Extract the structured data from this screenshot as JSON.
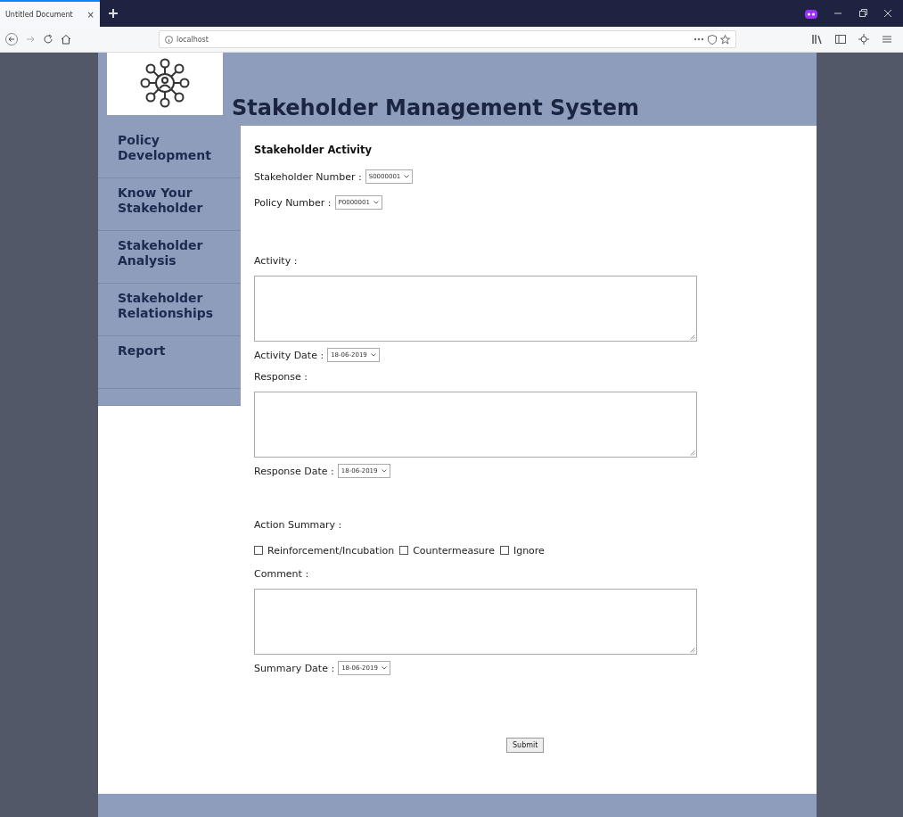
{
  "browser": {
    "tab_title": "Untitled Document",
    "tab_close": "×",
    "url": "localhost"
  },
  "header": {
    "title": "Stakeholder Management System"
  },
  "sidebar": {
    "items": [
      {
        "label": "Policy Development",
        "selected": false
      },
      {
        "label": "Know Your Stakeholder",
        "selected": false
      },
      {
        "label": "Stakeholder Analysis",
        "selected": false
      },
      {
        "label": "Stakeholder Relationships",
        "selected": false
      },
      {
        "label": "Report",
        "selected": false
      }
    ]
  },
  "form": {
    "heading": "Stakeholder Activity",
    "fields": [
      {
        "kind": "select",
        "label": "Stakeholder Number :",
        "value": "S0000001"
      },
      {
        "kind": "select",
        "label": "Policy Number :",
        "value": "P0000001"
      },
      {
        "kind": "textarea",
        "label": "Activity :"
      },
      {
        "kind": "select",
        "label": "Activity Date :",
        "value": "18-06-2019"
      },
      {
        "kind": "textarea",
        "label": "Response :"
      },
      {
        "kind": "select",
        "label": "Response Date :",
        "value": "18-06-2019"
      },
      {
        "kind": "checkboxes",
        "label": "Action Summary :",
        "options": [
          {
            "label": "Reinforcement/Incubation",
            "checked": false
          },
          {
            "label": "Countermeasure",
            "checked": false
          },
          {
            "label": "Ignore",
            "checked": false
          }
        ]
      },
      {
        "kind": "textarea",
        "label": "Comment :"
      },
      {
        "kind": "select",
        "label": "Summary Date :",
        "value": "18-06-2019"
      }
    ],
    "submit": "Submit"
  }
}
